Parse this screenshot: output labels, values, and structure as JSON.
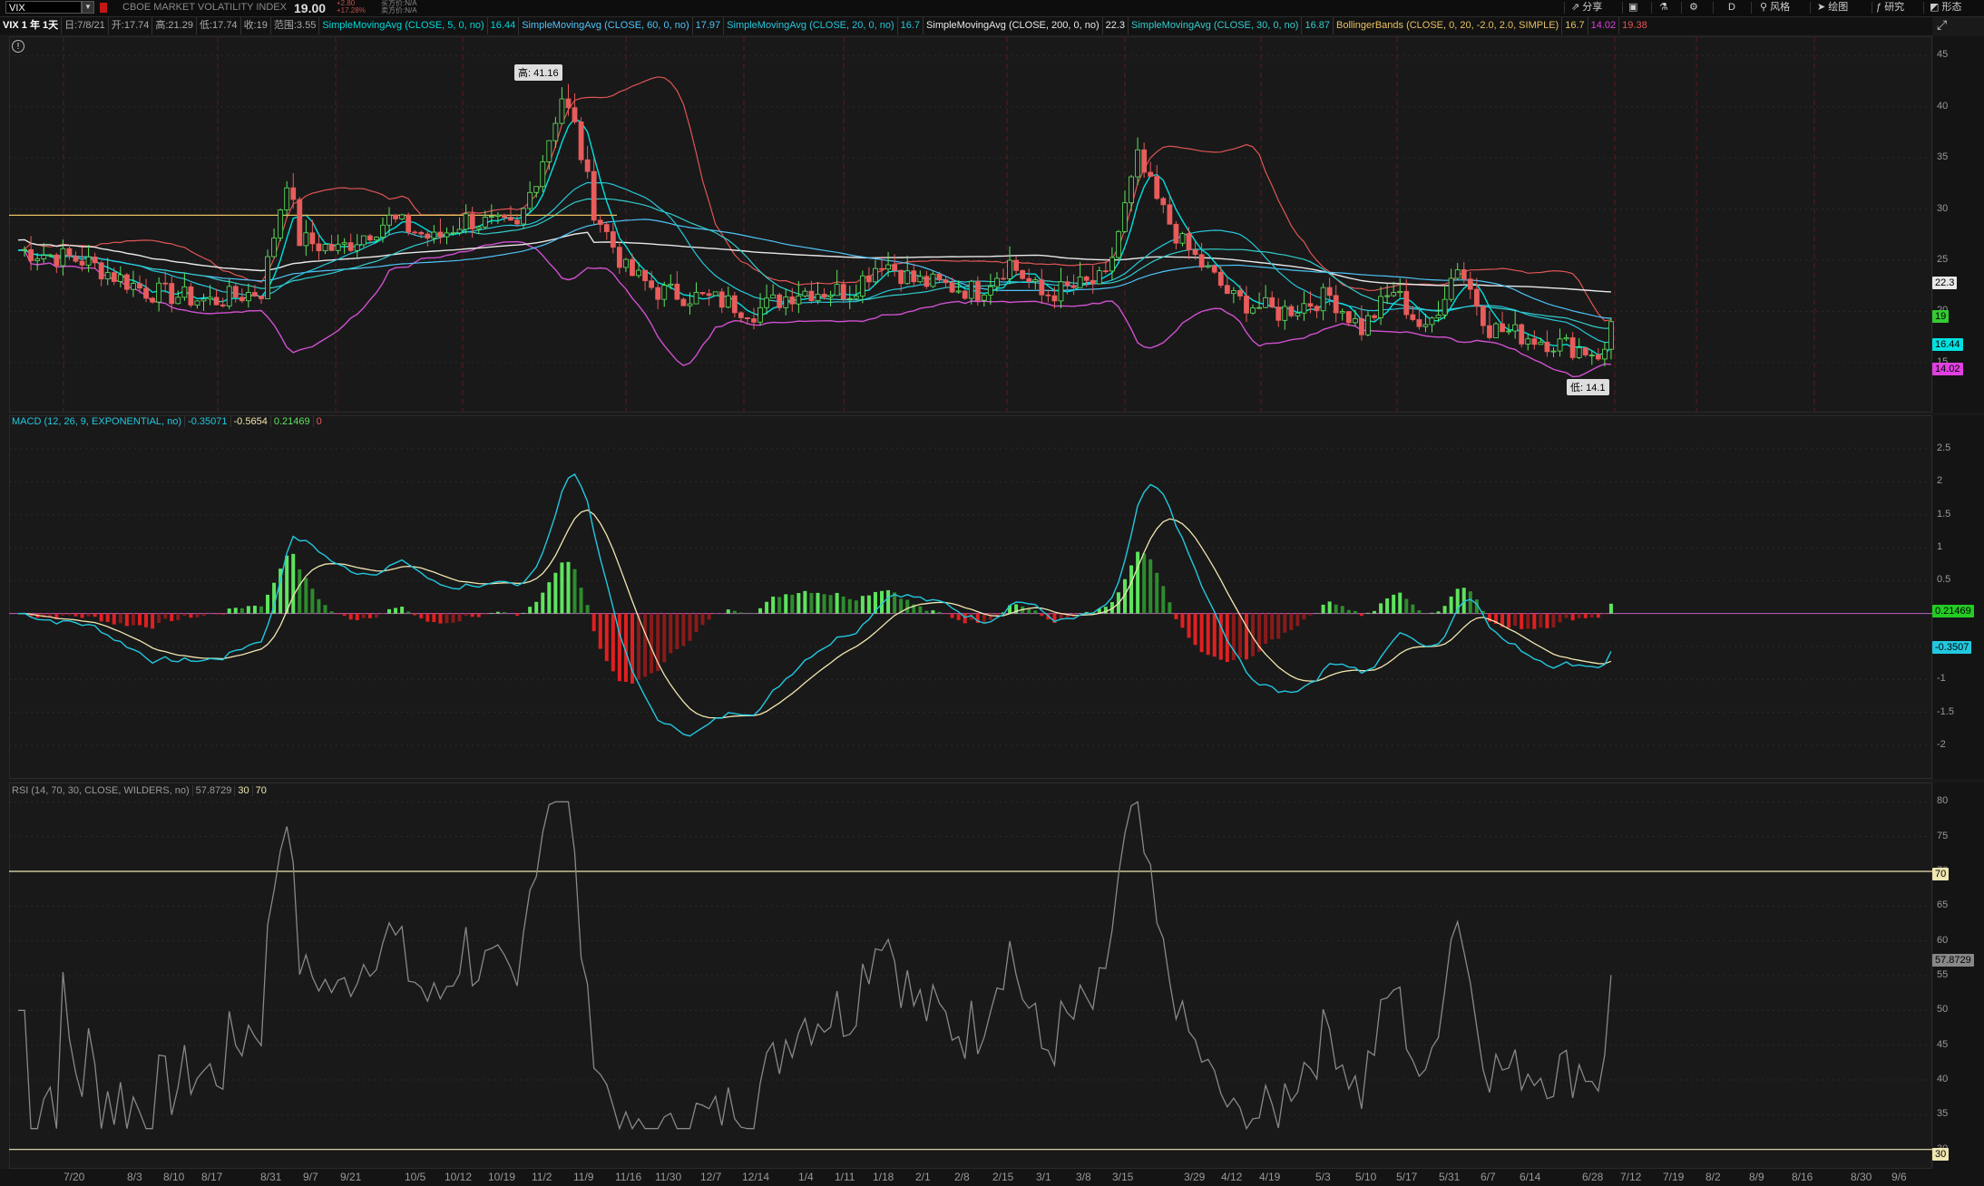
{
  "toolbar": {
    "symbol": "VIX",
    "security_name": "CBOE MARKET VOLATILITY INDEX",
    "last_price": "19.00",
    "change_abs": "+2.80",
    "change_pct": "+17.28%",
    "bid": "买方价:N/A",
    "ask": "卖方价:N/A",
    "buttons": [
      {
        "label": "分享",
        "icon": "share-icon"
      },
      {
        "label": "",
        "icon": "screenshot-icon"
      },
      {
        "label": "",
        "icon": "flask-icon"
      },
      {
        "label": "",
        "icon": "gear-icon"
      },
      {
        "label": "D",
        "icon": ""
      },
      {
        "label": "风格",
        "icon": "style-icon"
      },
      {
        "label": "绘图",
        "icon": "cursor-icon"
      },
      {
        "label": "研究",
        "icon": "studies-icon"
      },
      {
        "label": "形态",
        "icon": "patterns-icon"
      }
    ]
  },
  "studies": {
    "chart_title": "VIX 1 年 1天",
    "date": "日:7/8/21",
    "open": "开:17.74",
    "high": "高:21.29",
    "low": "低:17.74",
    "close": "收:19",
    "range": "范围:3.55",
    "sma5": "SimpleMovingAvg (CLOSE, 5, 0, no)",
    "sma5_val": "16.44",
    "sma60": "SimpleMovingAvg (CLOSE, 60, 0, no)",
    "sma60_val": "17.97",
    "sma20": "SimpleMovingAvg (CLOSE, 20, 0, no)",
    "sma20_val": "16.7",
    "sma200": "SimpleMovingAvg (CLOSE, 200, 0, no)",
    "sma200_val": "22.3",
    "sma30": "SimpleMovingAvg (CLOSE, 30, 0, no)",
    "sma30_val": "16.87",
    "bb": "BollingerBands (CLOSE, 0, 20, -2.0, 2.0, SIMPLE)",
    "bb_mid": "16.7",
    "bb_low": "14.02",
    "bb_up": "19.38"
  },
  "price_pane": {
    "high_label": "高: 41.16",
    "low_label": "低: 14.1",
    "axis_ticks": [
      "45",
      "40",
      "35",
      "30",
      "25",
      "20",
      "15"
    ],
    "tags": [
      {
        "text": "22.3",
        "color": "#e8e8e8"
      },
      {
        "text": "19",
        "color": "#33cc33"
      },
      {
        "text": "16.44",
        "color": "#00e0e0"
      },
      {
        "text": "14.02",
        "color": "#e040e0"
      }
    ]
  },
  "macd_pane": {
    "header": "MACD (12, 26, 9, EXPONENTIAL, no)",
    "value": "-0.35071",
    "avg": "-0.5654",
    "diff": "0.21469",
    "zero": "0",
    "axis_ticks": [
      "2.5",
      "2",
      "1.5",
      "1",
      "0.5",
      "0",
      "-0.5",
      "-1",
      "-1.5",
      "-2"
    ],
    "tag_diff": "0.21469",
    "tag_value": "-0.3507"
  },
  "rsi_pane": {
    "header": "RSI (14, 70, 30, CLOSE, WILDERS, no)",
    "value": "57.8729",
    "oversold": "30",
    "overbought": "70",
    "axis_ticks": [
      "80",
      "75",
      "70",
      "65",
      "60",
      "55",
      "50",
      "45",
      "40",
      "35",
      "30"
    ],
    "tag_value": "57.8729",
    "tag_70": "70",
    "tag_30": "30"
  },
  "x_axis": [
    "7/20",
    "8/3",
    "8/10",
    "8/17",
    "8/31",
    "9/7",
    "9/21",
    "10/5",
    "10/12",
    "10/19",
    "11/2",
    "11/9",
    "11/16",
    "11/30",
    "12/7",
    "12/14",
    "1/4",
    "1/11",
    "1/18",
    "2/1",
    "2/8",
    "2/15",
    "3/1",
    "3/8",
    "3/15",
    "3/29",
    "4/12",
    "4/19",
    "5/3",
    "5/10",
    "5/17",
    "5/31",
    "6/7",
    "6/14",
    "6/28",
    "7/12",
    "7/19",
    "8/2",
    "8/9",
    "8/16",
    "8/30",
    "9/6"
  ],
  "colors": {
    "up": "#5ee35e",
    "down": "#e85c5c",
    "sma5": "#00e0e0",
    "sma200": "#e8e8e8",
    "bb_upper": "#e05555",
    "bb_lower": "#d050d0",
    "macd_line": "#22c8e0",
    "macd_avg": "#f0e6b0",
    "rsi": "#888888"
  }
}
